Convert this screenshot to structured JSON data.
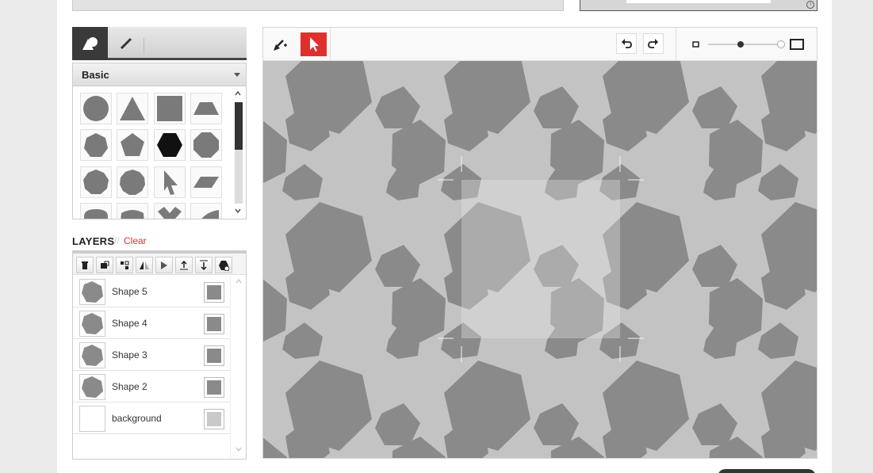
{
  "shape_panel": {
    "tabs": [
      {
        "name": "shapes-tab",
        "icon": "shapes-icon",
        "active": true
      },
      {
        "name": "draw-tab",
        "icon": "pencil-icon",
        "active": false
      }
    ],
    "category": "Basic",
    "shapes": [
      "circle-icon",
      "triangle-icon",
      "square-icon",
      "trapezoid-icon",
      "heptagon-icon",
      "pentagon-icon",
      "hexagon-icon",
      "octagon-icon",
      "nonagon-icon",
      "decagon-icon",
      "arrow-cursor-icon",
      "parallelogram-icon",
      "rounded-shape-icon",
      "rounded-shape-2-icon",
      "x-shape-icon",
      "curve-shape-icon"
    ],
    "selected_shape": "hexagon-icon"
  },
  "layers": {
    "title": "LAYERS",
    "separator": "//",
    "clear_label": "Clear",
    "toolbar": [
      "delete-icon",
      "duplicate-icon",
      "group-icon",
      "flip-horizontal-icon",
      "flip-vertical-icon",
      "bring-to-front-icon",
      "send-to-back-icon",
      "add-shape-layer-icon"
    ],
    "items": [
      {
        "name": "Shape 5",
        "color": "#8a8a8a",
        "type": "hexagon"
      },
      {
        "name": "Shape 4",
        "color": "#8a8a8a",
        "type": "hexagon"
      },
      {
        "name": "Shape 3",
        "color": "#8a8a8a",
        "type": "hexagon"
      },
      {
        "name": "Shape 2",
        "color": "#8a8a8a",
        "type": "hexagon"
      },
      {
        "name": "background",
        "color": "#c9c9c9",
        "type": "blank"
      }
    ]
  },
  "editor": {
    "tools": [
      "pen-add-icon",
      "select-arrow-icon"
    ],
    "selected_tool": "select-arrow-icon",
    "undo_icon": "undo-icon",
    "redo_icon": "redo-icon",
    "zoom_min_icon": "small-frame-icon",
    "zoom_max_icon": "large-frame-icon",
    "zoom_level": 0.45
  },
  "colors": {
    "accent": "#e0302d",
    "canvas_bg": "#c3c3c3",
    "shape_fill": "#8a8a8a",
    "selection_fill": "#cccccc"
  }
}
